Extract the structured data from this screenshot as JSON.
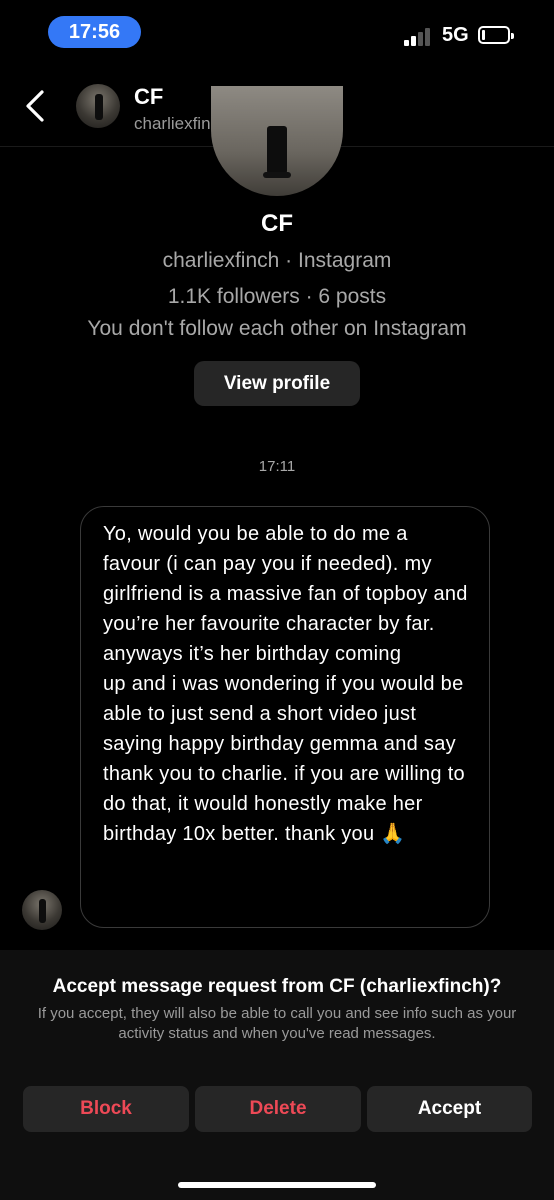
{
  "status_bar": {
    "time": "17:56",
    "network": "5G"
  },
  "header": {
    "name": "CF",
    "username": "charliexfinch"
  },
  "profile": {
    "name": "CF",
    "line1": "charliexfinch · Instagram",
    "line2": "1.1K followers · 6 posts",
    "line3": "You don't follow each other on Instagram",
    "view_profile_label": "View profile"
  },
  "thread": {
    "timestamp": "17:11",
    "message": "Yo, would you be able to do me a favour (i can pay you if needed). my girlfriend is a massive fan of topboy and you’re her favourite character by far. anyways it’s her birthday coming\nup and i was wondering if you would be able to just send a short video just saying happy birthday gemma and say thank you to charlie. if you are willing to do that, it would honestly make her birthday 10x better. thank you 🙏"
  },
  "request": {
    "title": "Accept message request from CF (charliexfinch)?",
    "body": "If you accept, they will also be able to call you and see info such as your activity status and when you've read messages.",
    "block_label": "Block",
    "delete_label": "Delete",
    "accept_label": "Accept"
  },
  "colors": {
    "accent_blue": "#3478f6",
    "danger_red": "#ed4956",
    "button_bg": "#262626"
  },
  "icons": [
    "back-chevron-icon",
    "signal-icon",
    "battery-icon"
  ]
}
